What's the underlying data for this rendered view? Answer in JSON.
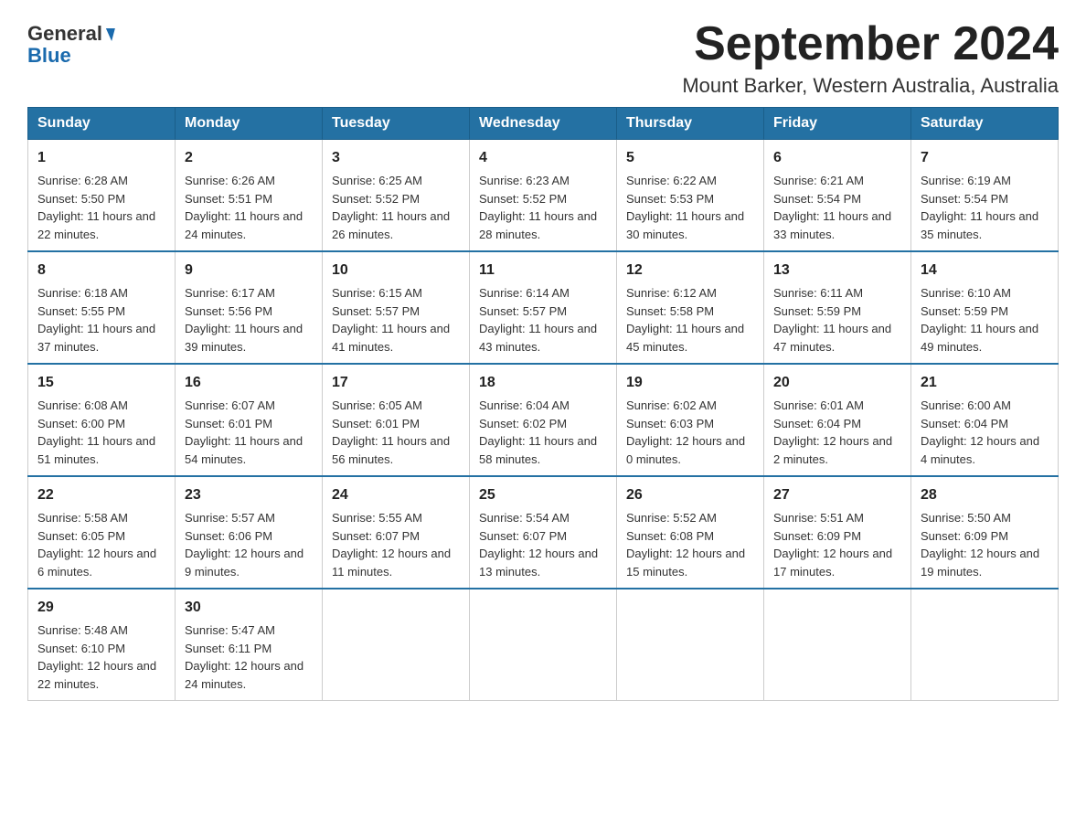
{
  "header": {
    "logo_text_general": "General",
    "logo_text_blue": "Blue",
    "title": "September 2024",
    "location": "Mount Barker, Western Australia, Australia"
  },
  "calendar": {
    "days_of_week": [
      "Sunday",
      "Monday",
      "Tuesday",
      "Wednesday",
      "Thursday",
      "Friday",
      "Saturday"
    ],
    "weeks": [
      [
        {
          "day": "1",
          "sunrise": "6:28 AM",
          "sunset": "5:50 PM",
          "daylight": "11 hours and 22 minutes."
        },
        {
          "day": "2",
          "sunrise": "6:26 AM",
          "sunset": "5:51 PM",
          "daylight": "11 hours and 24 minutes."
        },
        {
          "day": "3",
          "sunrise": "6:25 AM",
          "sunset": "5:52 PM",
          "daylight": "11 hours and 26 minutes."
        },
        {
          "day": "4",
          "sunrise": "6:23 AM",
          "sunset": "5:52 PM",
          "daylight": "11 hours and 28 minutes."
        },
        {
          "day": "5",
          "sunrise": "6:22 AM",
          "sunset": "5:53 PM",
          "daylight": "11 hours and 30 minutes."
        },
        {
          "day": "6",
          "sunrise": "6:21 AM",
          "sunset": "5:54 PM",
          "daylight": "11 hours and 33 minutes."
        },
        {
          "day": "7",
          "sunrise": "6:19 AM",
          "sunset": "5:54 PM",
          "daylight": "11 hours and 35 minutes."
        }
      ],
      [
        {
          "day": "8",
          "sunrise": "6:18 AM",
          "sunset": "5:55 PM",
          "daylight": "11 hours and 37 minutes."
        },
        {
          "day": "9",
          "sunrise": "6:17 AM",
          "sunset": "5:56 PM",
          "daylight": "11 hours and 39 minutes."
        },
        {
          "day": "10",
          "sunrise": "6:15 AM",
          "sunset": "5:57 PM",
          "daylight": "11 hours and 41 minutes."
        },
        {
          "day": "11",
          "sunrise": "6:14 AM",
          "sunset": "5:57 PM",
          "daylight": "11 hours and 43 minutes."
        },
        {
          "day": "12",
          "sunrise": "6:12 AM",
          "sunset": "5:58 PM",
          "daylight": "11 hours and 45 minutes."
        },
        {
          "day": "13",
          "sunrise": "6:11 AM",
          "sunset": "5:59 PM",
          "daylight": "11 hours and 47 minutes."
        },
        {
          "day": "14",
          "sunrise": "6:10 AM",
          "sunset": "5:59 PM",
          "daylight": "11 hours and 49 minutes."
        }
      ],
      [
        {
          "day": "15",
          "sunrise": "6:08 AM",
          "sunset": "6:00 PM",
          "daylight": "11 hours and 51 minutes."
        },
        {
          "day": "16",
          "sunrise": "6:07 AM",
          "sunset": "6:01 PM",
          "daylight": "11 hours and 54 minutes."
        },
        {
          "day": "17",
          "sunrise": "6:05 AM",
          "sunset": "6:01 PM",
          "daylight": "11 hours and 56 minutes."
        },
        {
          "day": "18",
          "sunrise": "6:04 AM",
          "sunset": "6:02 PM",
          "daylight": "11 hours and 58 minutes."
        },
        {
          "day": "19",
          "sunrise": "6:02 AM",
          "sunset": "6:03 PM",
          "daylight": "12 hours and 0 minutes."
        },
        {
          "day": "20",
          "sunrise": "6:01 AM",
          "sunset": "6:04 PM",
          "daylight": "12 hours and 2 minutes."
        },
        {
          "day": "21",
          "sunrise": "6:00 AM",
          "sunset": "6:04 PM",
          "daylight": "12 hours and 4 minutes."
        }
      ],
      [
        {
          "day": "22",
          "sunrise": "5:58 AM",
          "sunset": "6:05 PM",
          "daylight": "12 hours and 6 minutes."
        },
        {
          "day": "23",
          "sunrise": "5:57 AM",
          "sunset": "6:06 PM",
          "daylight": "12 hours and 9 minutes."
        },
        {
          "day": "24",
          "sunrise": "5:55 AM",
          "sunset": "6:07 PM",
          "daylight": "12 hours and 11 minutes."
        },
        {
          "day": "25",
          "sunrise": "5:54 AM",
          "sunset": "6:07 PM",
          "daylight": "12 hours and 13 minutes."
        },
        {
          "day": "26",
          "sunrise": "5:52 AM",
          "sunset": "6:08 PM",
          "daylight": "12 hours and 15 minutes."
        },
        {
          "day": "27",
          "sunrise": "5:51 AM",
          "sunset": "6:09 PM",
          "daylight": "12 hours and 17 minutes."
        },
        {
          "day": "28",
          "sunrise": "5:50 AM",
          "sunset": "6:09 PM",
          "daylight": "12 hours and 19 minutes."
        }
      ],
      [
        {
          "day": "29",
          "sunrise": "5:48 AM",
          "sunset": "6:10 PM",
          "daylight": "12 hours and 22 minutes."
        },
        {
          "day": "30",
          "sunrise": "5:47 AM",
          "sunset": "6:11 PM",
          "daylight": "12 hours and 24 minutes."
        },
        null,
        null,
        null,
        null,
        null
      ]
    ]
  }
}
